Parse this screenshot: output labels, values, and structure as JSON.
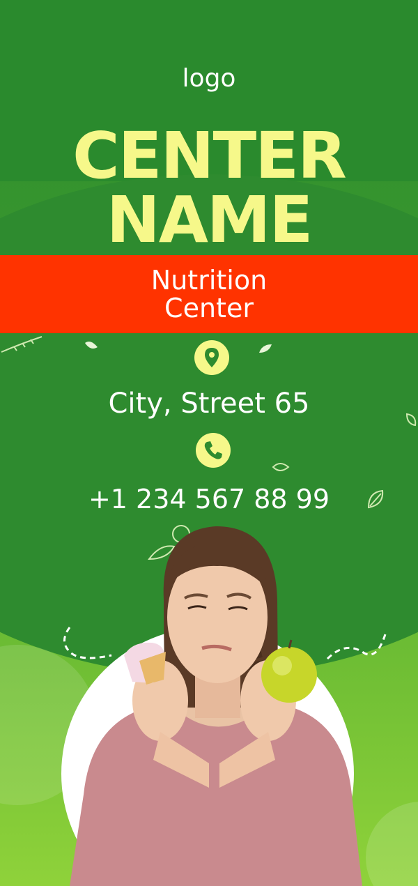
{
  "header": {
    "logo": "logo"
  },
  "title": {
    "line1": "CENTER",
    "line2": "NAME"
  },
  "ribbon": {
    "line1": "Nutrition",
    "line2": "Center"
  },
  "contact": {
    "address": "City, Street 65",
    "phone": "+1 234 567 88 99",
    "location_icon": "map-pin-icon",
    "phone_icon": "phone-icon"
  },
  "colors": {
    "green_dark": "#2e8b2f",
    "green_light": "#8fd23a",
    "accent_yellow": "#f6f88a",
    "ribbon_red": "#ff3300",
    "text": "#ffffff"
  }
}
